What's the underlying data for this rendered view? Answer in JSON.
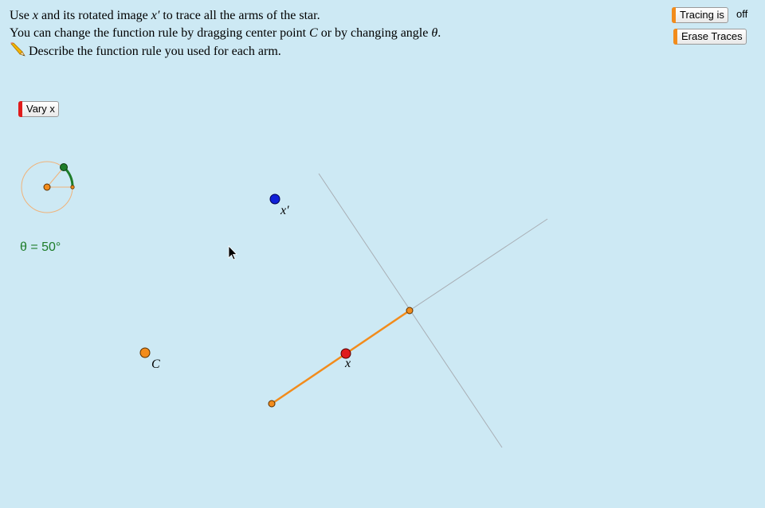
{
  "instructions": {
    "line1_a": "Use ",
    "line1_x": "x",
    "line1_b": " and its rotated image ",
    "line1_xp": "x′",
    "line1_c": " to trace all the arms of the star.",
    "line2_a": "You can change the function rule by dragging center point ",
    "line2_c": "C",
    "line2_b": " or by changing angle ",
    "line2_theta": "θ",
    "line2_end": ".",
    "line3": "Describe the function rule you used for each arm."
  },
  "buttons": {
    "tracing_label": "Tracing is",
    "tracing_state": "off",
    "erase_label": "Erase Traces",
    "vary_label": "Vary x"
  },
  "angle": {
    "label": "θ = 50°",
    "value_deg": 50
  },
  "points": {
    "x_label": "x",
    "x_prime_label": "x′",
    "c_label": "C"
  },
  "colors": {
    "background": "#cde9f4",
    "orange": "#f28c1c",
    "red": "#e01b1b",
    "blue": "#1020d8",
    "green": "#1e7d2a",
    "guide": "#a8aeb4"
  },
  "icons": [
    "pencil-icon",
    "cursor-icon"
  ]
}
